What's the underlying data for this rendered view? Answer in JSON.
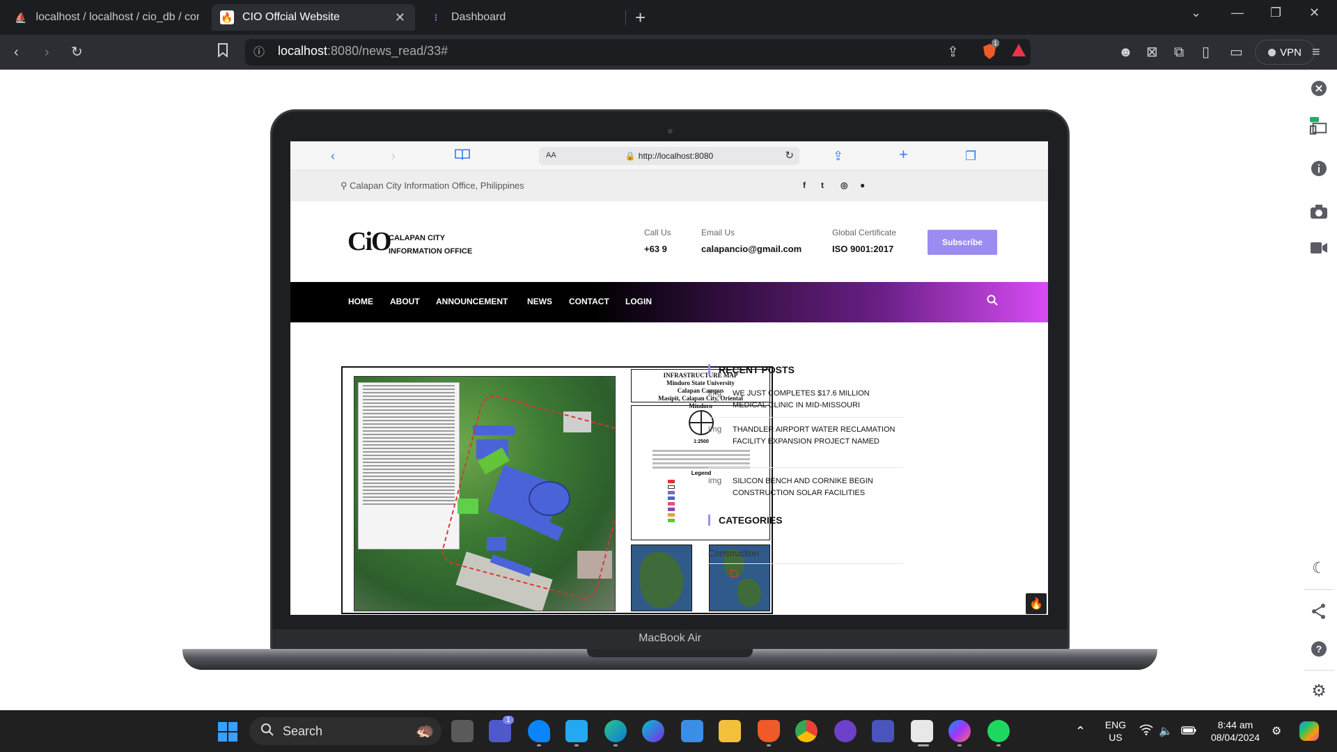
{
  "browser": {
    "tabs": [
      {
        "title": "localhost / localhost / cio_db / comm"
      },
      {
        "title": "CIO Offcial Website"
      },
      {
        "title": "Dashboard"
      }
    ],
    "url": {
      "host": "localhost",
      "path": ":8080/news_read/33#"
    },
    "vpn_label": "VPN",
    "brave_badge": "1"
  },
  "laptop": {
    "label": "MacBook Air"
  },
  "safari": {
    "url": "http://localhost:8080",
    "aa_label": "AA"
  },
  "site": {
    "location": "Calapan City Information Office, Philippines",
    "logo": {
      "mark": "CiO",
      "line1": "CALAPAN CITY",
      "line2": "INFORMATION OFFICE"
    },
    "contact": [
      {
        "label": "Call Us",
        "value": "+63 9"
      },
      {
        "label": "Email Us",
        "value": "calapancio@gmail.com"
      },
      {
        "label": "Global Certificate",
        "value": "ISO 9001:2017"
      }
    ],
    "subscribe_label": "Subscribe",
    "nav": [
      "HOME",
      "ABOUT",
      "ANNOUNCEMENT",
      "NEWS",
      "CONTACT",
      "LOGIN"
    ],
    "colors": {
      "accent": "#9b8cf2",
      "nav_gradient_end": "#d84cf5"
    }
  },
  "map": {
    "title_lines": [
      "INFRASTRUCTURE MAP",
      "Mindoro State University",
      "Calapan Campus",
      "Masipit, Calapan City, Oriental",
      "Mindoro"
    ],
    "scale": "1:2500",
    "legend_label": "Legend"
  },
  "sidebar": {
    "recent_title": "RECENT POSTS",
    "posts": [
      {
        "thumb": "img",
        "title": "WE JUST COMPLETES $17.6 MILLION MEDICAL CLINIC IN MID-MISSOURI"
      },
      {
        "thumb": "img",
        "title": "THANDLER AIRPORT WATER RECLAMATION FACILITY EXPANSION PROJECT NAMED"
      },
      {
        "thumb": "img",
        "title": "SILICON BENCH AND CORNIKE BEGIN CONSTRUCTION SOLAR FACILITIES"
      }
    ],
    "categories_title": "CATEGORIES",
    "categories": [
      "Construction"
    ]
  },
  "taskbar": {
    "search_label": "Search",
    "lang": "ENG",
    "region": "US",
    "time": "8:44 am",
    "date": "08/04/2024",
    "teams_badge": "1"
  }
}
